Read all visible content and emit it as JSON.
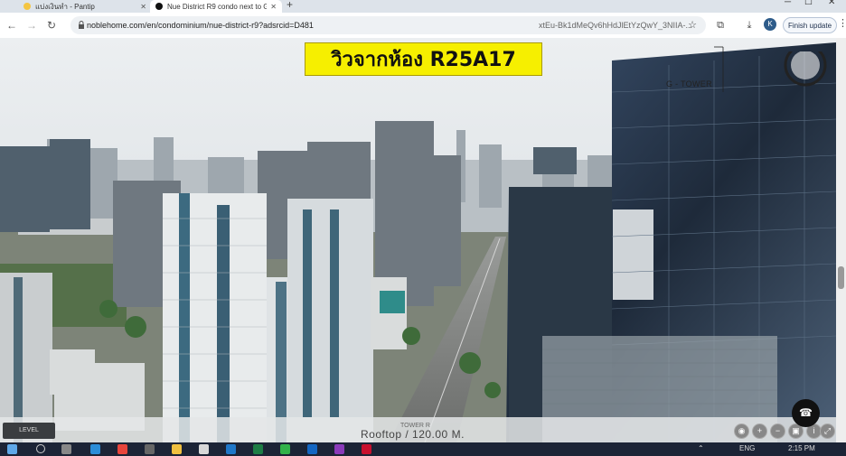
{
  "browser": {
    "tabs": [
      {
        "label": "แบ่งเงินทำ - Pantip",
        "favicon_color": "#f4c542",
        "active": false
      },
      {
        "label": "Nue District R9 condo next to G",
        "favicon_color": "#111111",
        "active": true
      }
    ],
    "new_tab_label": "+",
    "url": "noblehome.com/en/condominium/nue-district-r9?adsrcid=D481",
    "url_tail": "xtEu-Bk1dMeQv6hHdJlEtYzQwY_3NIIA-...",
    "avatar_letter": "K",
    "finish_update_label": "Finish update"
  },
  "overlay": {
    "banner_text": "วิวจากห้อง R25A17",
    "g_tower_label": "G - TOWER",
    "level_label": "LEVEL",
    "tower_label": "TOWER R",
    "rooftop_label": "Rooftop / 120.00 M."
  },
  "taskbar": {
    "time": "2:15 PM",
    "language": "ENG"
  },
  "colors": {
    "banner_bg": "#f6ef00",
    "sky": "#dde2e6",
    "taskbar": "#1c2436"
  }
}
